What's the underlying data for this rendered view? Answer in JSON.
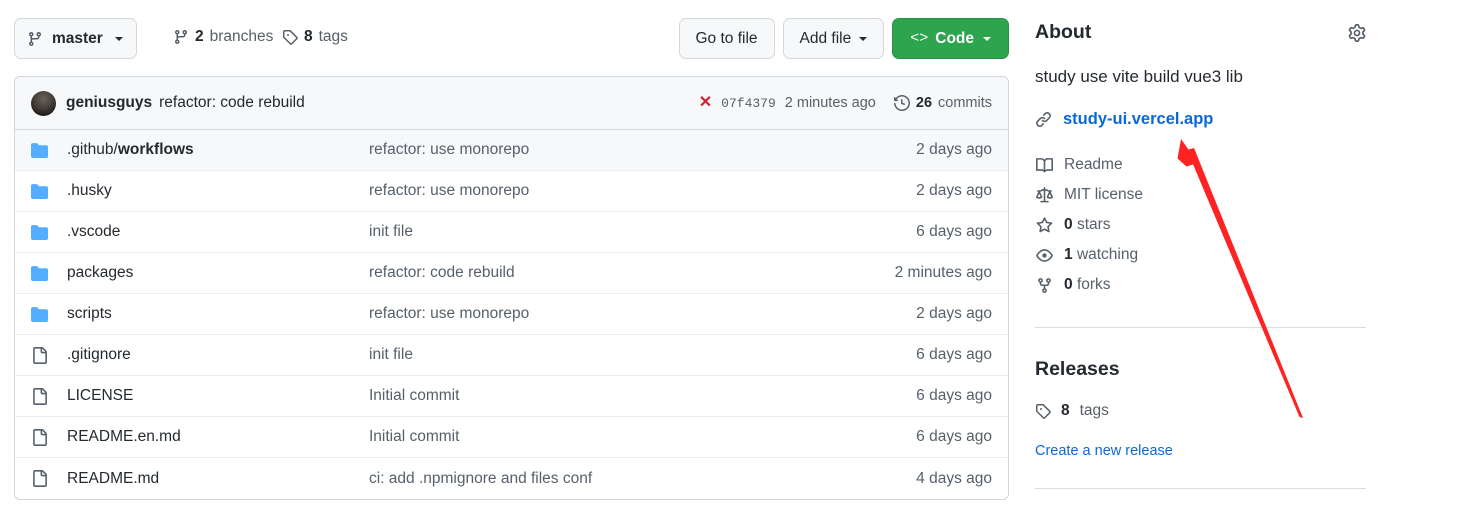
{
  "toolbar": {
    "branch": {
      "label": "master",
      "icon": "git-branch-icon"
    },
    "branches": {
      "count": "2",
      "label": "branches",
      "icon": "git-branch-icon"
    },
    "tags": {
      "count": "8",
      "label": "tags",
      "icon": "tag-icon"
    },
    "go_to_file": "Go to file",
    "add_file": "Add file",
    "code": "Code",
    "code_glyph": "<>",
    "code_color": "#2da44e"
  },
  "commit_bar": {
    "author": "geniusguys",
    "message": "refactor: code rebuild",
    "status_icon": "x-icon",
    "status_color": "#cf222e",
    "sha": "07f4379",
    "time": "2 minutes ago",
    "commits_count": "26",
    "commits_label": "commits",
    "history_icon": "history-icon"
  },
  "files": [
    {
      "type": "folder",
      "icon": "folder-icon",
      "name": ".github/workflows",
      "name_prefix": ".github/",
      "name_bold": "workflows",
      "message": "refactor: use monorepo",
      "date": "2 days ago",
      "shaded": true
    },
    {
      "type": "folder",
      "icon": "folder-icon",
      "name": ".husky",
      "name_prefix": ".husky",
      "name_bold": "",
      "message": "refactor: use monorepo",
      "date": "2 days ago",
      "shaded": false
    },
    {
      "type": "folder",
      "icon": "folder-icon",
      "name": ".vscode",
      "name_prefix": ".vscode",
      "name_bold": "",
      "message": "init file",
      "date": "6 days ago",
      "shaded": false
    },
    {
      "type": "folder",
      "icon": "folder-icon",
      "name": "packages",
      "name_prefix": "packages",
      "name_bold": "",
      "message": "refactor: code rebuild",
      "date": "2 minutes ago",
      "shaded": false
    },
    {
      "type": "folder",
      "icon": "folder-icon",
      "name": "scripts",
      "name_prefix": "scripts",
      "name_bold": "",
      "message": "refactor: use monorepo",
      "date": "2 days ago",
      "shaded": false
    },
    {
      "type": "file",
      "icon": "file-icon",
      "name": ".gitignore",
      "name_prefix": ".gitignore",
      "name_bold": "",
      "message": "init file",
      "date": "6 days ago",
      "shaded": false
    },
    {
      "type": "file",
      "icon": "file-icon",
      "name": "LICENSE",
      "name_prefix": "LICENSE",
      "name_bold": "",
      "message": "Initial commit",
      "date": "6 days ago",
      "shaded": false
    },
    {
      "type": "file",
      "icon": "file-icon",
      "name": "README.en.md",
      "name_prefix": "README.en.md",
      "name_bold": "",
      "message": "Initial commit",
      "date": "6 days ago",
      "shaded": false
    },
    {
      "type": "file",
      "icon": "file-icon",
      "name": "README.md",
      "name_prefix": "README.md",
      "name_bold": "",
      "message": "ci: add .npmignore and files conf",
      "date": "4 days ago",
      "shaded": false
    }
  ],
  "sidebar": {
    "about_title": "About",
    "settings_icon": "gear-icon",
    "description": "study use vite build vue3 lib",
    "link": {
      "text": "study-ui.vercel.app",
      "icon": "link-icon",
      "color": "#0969da"
    },
    "meta": [
      {
        "icon": "book-icon",
        "value": "",
        "label": "Readme"
      },
      {
        "icon": "law-icon",
        "value": "",
        "label": "MIT license"
      },
      {
        "icon": "star-icon",
        "value": "0",
        "label": "stars"
      },
      {
        "icon": "eye-icon",
        "value": "1",
        "label": "watching"
      },
      {
        "icon": "fork-icon",
        "value": "0",
        "label": "forks"
      }
    ],
    "releases_title": "Releases",
    "releases_tags_count": "8",
    "releases_tags_label": "tags",
    "releases_tag_icon": "tag-icon",
    "create_release": "Create a new release"
  },
  "annotation": {
    "type": "arrow",
    "color": "#f22",
    "points_to": "study-ui.vercel.app"
  }
}
